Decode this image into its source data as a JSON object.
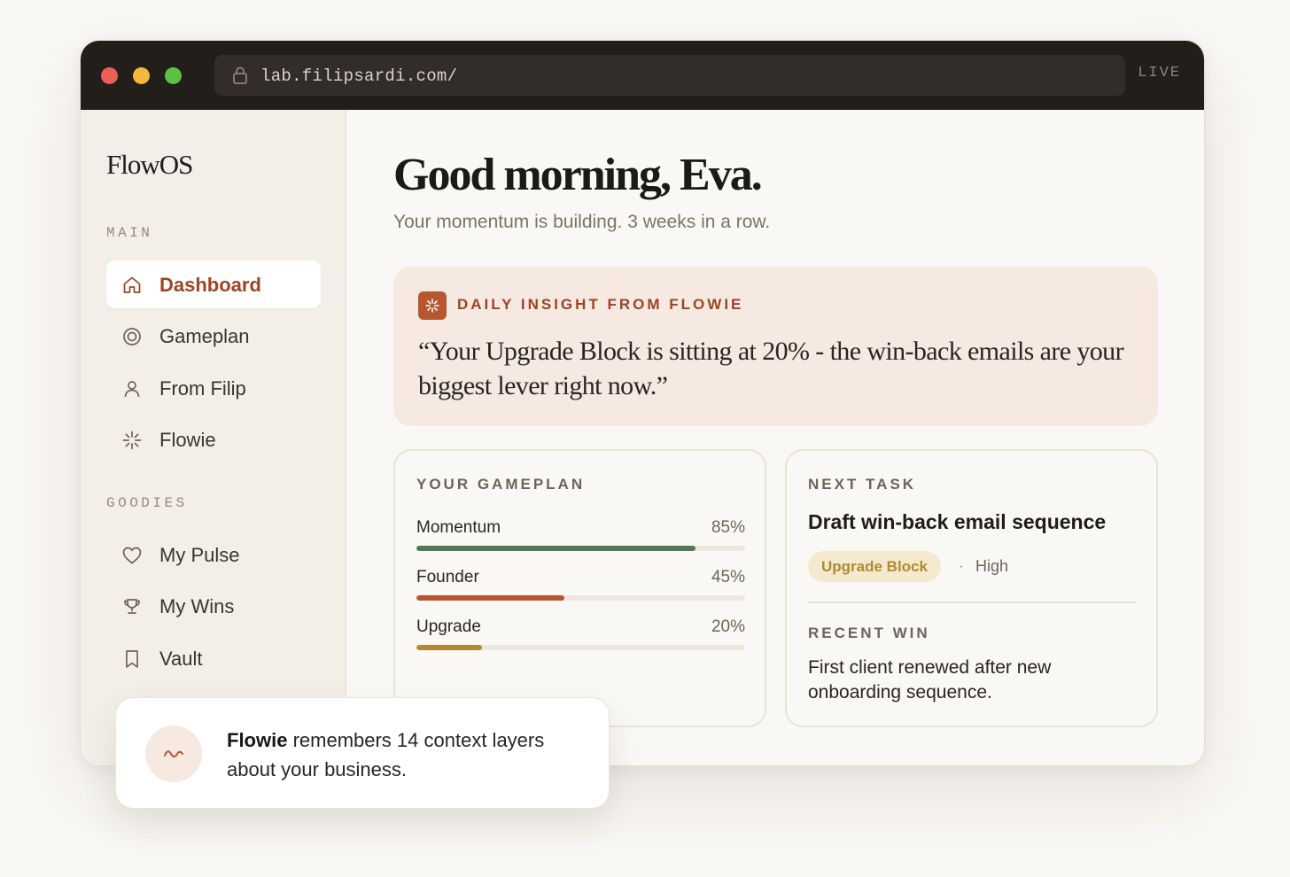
{
  "browser": {
    "url": "lab.filipsardi.com/",
    "status": "LIVE"
  },
  "sidebar": {
    "logo": "FlowOS",
    "sections": [
      {
        "label": "MAIN",
        "items": [
          {
            "label": "Dashboard",
            "icon": "home-icon",
            "active": true
          },
          {
            "label": "Gameplan",
            "icon": "target-icon"
          },
          {
            "label": "From Filip",
            "icon": "user-icon"
          },
          {
            "label": "Flowie",
            "icon": "sparkle-icon"
          }
        ]
      },
      {
        "label": "GOODIES",
        "items": [
          {
            "label": "My Pulse",
            "icon": "heart-icon"
          },
          {
            "label": "My Wins",
            "icon": "trophy-icon"
          },
          {
            "label": "Vault",
            "icon": "bookmark-icon"
          }
        ]
      }
    ]
  },
  "main": {
    "greeting": "Good morning, Eva.",
    "subtitle": "Your momentum is building. 3 weeks in a row.",
    "insight": {
      "label": "DAILY INSIGHT FROM FLOWIE",
      "quote": "“Your Upgrade Block is sitting at 20% - the win-back emails are your biggest lever right now.”"
    },
    "gameplan": {
      "label": "YOUR GAMEPLAN",
      "items": [
        {
          "name": "Momentum",
          "percent_label": "85%",
          "value": 0.85,
          "color": "#4e7a5a"
        },
        {
          "name": "Founder",
          "percent_label": "45%",
          "value": 0.45,
          "color": "#b8562f"
        },
        {
          "name": "Upgrade",
          "percent_label": "20%",
          "value": 0.2,
          "color": "#b08a3a"
        }
      ]
    },
    "next_task": {
      "label": "NEXT TASK",
      "title": "Draft win-back email sequence",
      "badge": "Upgrade Block",
      "separator": "·",
      "priority": "High"
    },
    "recent_win": {
      "label": "RECENT WIN",
      "text": "First client renewed after new onboarding sequence."
    }
  },
  "toast": {
    "bold": "Flowie",
    "text": " remembers 14 context layers about your business.",
    "icon": "wave-icon"
  },
  "colors": {
    "accent": "#b8562f",
    "accent_text": "#9e4324",
    "insight_bg": "#f5e9e1",
    "badge_bg": "#f4e9cf",
    "badge_text": "#b08a2d"
  }
}
